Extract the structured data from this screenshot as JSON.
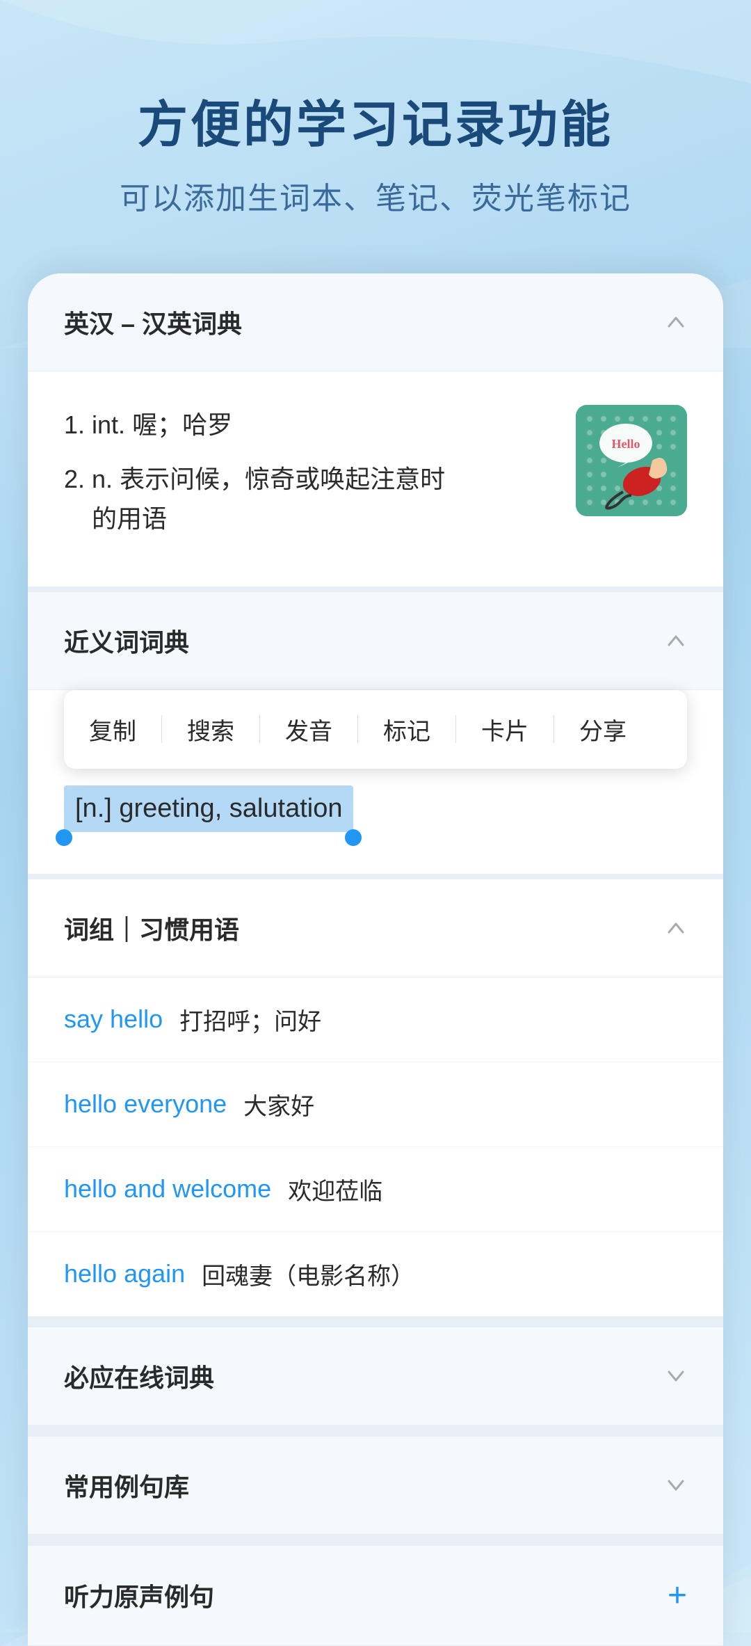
{
  "header": {
    "title": "方便的学习记录功能",
    "subtitle": "可以添加生词本、笔记、荧光笔标记"
  },
  "dict_section": {
    "title": "英汉 – 汉英词典",
    "chevron": "up"
  },
  "dict_entries": [
    {
      "index": "1.",
      "pos": "int.",
      "definition": "喔；哈罗"
    },
    {
      "index": "2.",
      "pos": "n.",
      "definition": "表示问候，惊奇或唤起注意时的用语"
    }
  ],
  "synonyms_section": {
    "title": "近义词词典",
    "chevron": "up"
  },
  "context_menu": {
    "items": [
      "复制",
      "搜索",
      "发音",
      "标记",
      "卡片",
      "分享"
    ]
  },
  "highlighted_text": "[n.] greeting, salutation",
  "phrases_section": {
    "title": "词组｜习惯用语",
    "chevron": "up"
  },
  "phrases": [
    {
      "english": "say hello",
      "chinese": "打招呼；问好"
    },
    {
      "english": "hello everyone",
      "chinese": "大家好"
    },
    {
      "english": "hello and welcome",
      "chinese": "欢迎莅临"
    },
    {
      "english": "hello again",
      "chinese": "回魂妻（电影名称）"
    }
  ],
  "collapsed_sections": [
    {
      "title": "必应在线词典",
      "chevron": "down"
    },
    {
      "title": "常用例句库",
      "chevron": "down"
    },
    {
      "title": "听力原声例句",
      "plus": "+"
    }
  ],
  "icons": {
    "chevron_up": "∧",
    "chevron_down": "∨",
    "plus": "+"
  }
}
